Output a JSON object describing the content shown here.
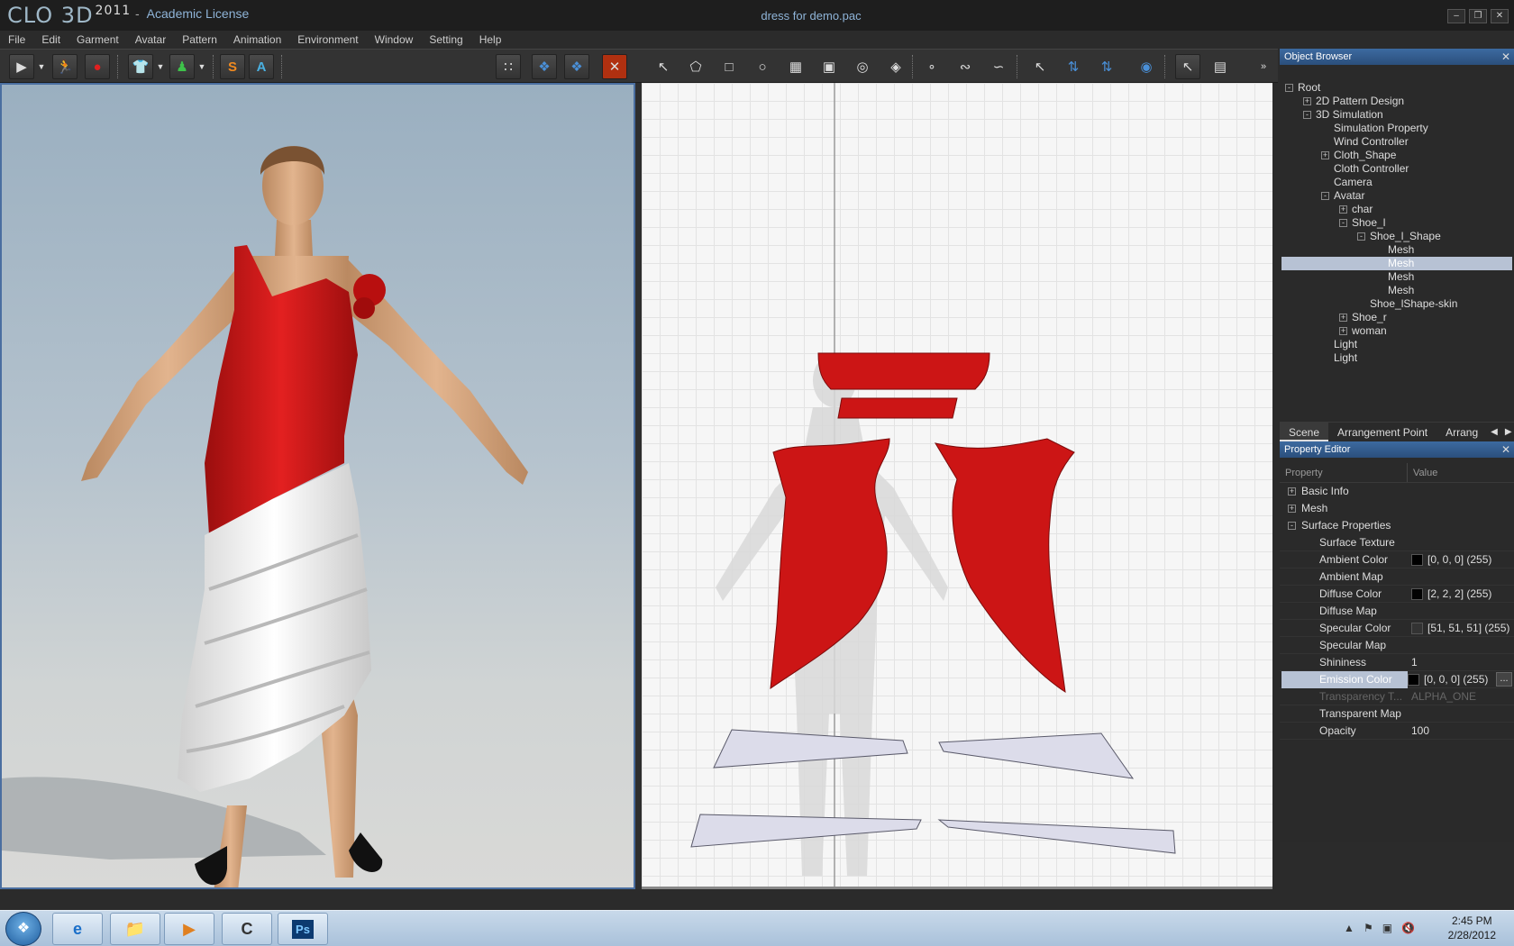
{
  "window": {
    "logo": "CLO 3D",
    "logo_version": "2011",
    "license": "Academic License",
    "document_title": "dress for demo.pac"
  },
  "menu": [
    "File",
    "Edit",
    "Garment",
    "Avatar",
    "Pattern",
    "Animation",
    "Environment",
    "Window",
    "Setting",
    "Help"
  ],
  "toolbar": {
    "s_button": "S",
    "a_button": "A"
  },
  "object_browser": {
    "title": "Object Browser",
    "tree": [
      {
        "label": "Root",
        "level": 0,
        "expander": "-"
      },
      {
        "label": "2D Pattern Design",
        "level": 1,
        "expander": "+"
      },
      {
        "label": "3D Simulation",
        "level": 1,
        "expander": "-"
      },
      {
        "label": "Simulation Property",
        "level": 2,
        "expander": ""
      },
      {
        "label": "Wind Controller",
        "level": 2,
        "expander": ""
      },
      {
        "label": "Cloth_Shape",
        "level": 2,
        "expander": "+"
      },
      {
        "label": "Cloth Controller",
        "level": 2,
        "expander": ""
      },
      {
        "label": "Camera",
        "level": 2,
        "expander": ""
      },
      {
        "label": "Avatar",
        "level": 2,
        "expander": "-"
      },
      {
        "label": "char",
        "level": 3,
        "expander": "+"
      },
      {
        "label": "Shoe_l",
        "level": 3,
        "expander": "-"
      },
      {
        "label": "Shoe_l_Shape",
        "level": 4,
        "expander": "-"
      },
      {
        "label": "Mesh",
        "level": 5,
        "expander": ""
      },
      {
        "label": "Mesh",
        "level": 5,
        "expander": "",
        "selected": true
      },
      {
        "label": "Mesh",
        "level": 5,
        "expander": ""
      },
      {
        "label": "Mesh",
        "level": 5,
        "expander": ""
      },
      {
        "label": "Shoe_lShape-skin",
        "level": 4,
        "expander": ""
      },
      {
        "label": "Shoe_r",
        "level": 3,
        "expander": "+"
      },
      {
        "label": "woman",
        "level": 3,
        "expander": "+"
      },
      {
        "label": "Light",
        "level": 2,
        "expander": ""
      },
      {
        "label": "Light",
        "level": 2,
        "expander": ""
      }
    ],
    "tabs": [
      "Scene",
      "Arrangement Point",
      "Arrang"
    ]
  },
  "property_editor": {
    "title": "Property Editor",
    "col_property": "Property",
    "col_value": "Value",
    "groups": [
      {
        "label": "Basic Info",
        "expander": "+"
      },
      {
        "label": "Mesh",
        "expander": "+"
      },
      {
        "label": "Surface Properties",
        "expander": "-"
      }
    ],
    "rows": [
      {
        "name": "Surface Texture",
        "value": ""
      },
      {
        "name": "Ambient Color",
        "value": "[0, 0, 0] (255)",
        "swatch": "#000000"
      },
      {
        "name": "Ambient Map",
        "value": ""
      },
      {
        "name": "Diffuse Color",
        "value": "[2, 2, 2] (255)",
        "swatch": "#020202"
      },
      {
        "name": "Diffuse Map",
        "value": ""
      },
      {
        "name": "Specular Color",
        "value": "[51, 51, 51] (255)",
        "swatch": "#333333"
      },
      {
        "name": "Specular Map",
        "value": ""
      },
      {
        "name": "Shininess",
        "value": "1"
      },
      {
        "name": "Emission Color",
        "value": "[0, 0, 0] (255)",
        "swatch": "#000000",
        "selected": true
      },
      {
        "name": "Transparency T...",
        "value": "ALPHA_ONE",
        "disabled": true
      },
      {
        "name": "Transparent Map",
        "value": ""
      },
      {
        "name": "Opacity",
        "value": "100"
      }
    ],
    "ellipsis": "..."
  },
  "taskbar": {
    "time": "2:45 PM",
    "date": "2/28/2012"
  },
  "colors": {
    "fabric_red": "#cc1515",
    "selection": "#b7c2d4",
    "panel_title": "#3c6aa0"
  }
}
